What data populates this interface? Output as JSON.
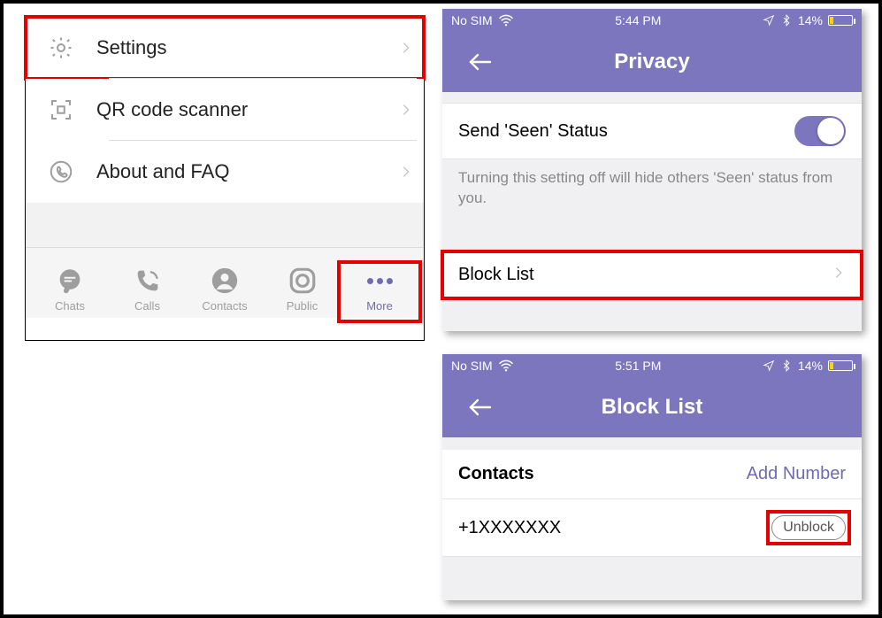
{
  "left": {
    "rows": {
      "settings": "Settings",
      "qr": "QR code scanner",
      "about": "About and FAQ"
    },
    "tabs": {
      "chats": "Chats",
      "calls": "Calls",
      "contacts": "Contacts",
      "public": "Public",
      "more": "More"
    }
  },
  "privacy": {
    "status": {
      "carrier": "No SIM",
      "time": "5:44 PM",
      "battery": "14%"
    },
    "title": "Privacy",
    "seen_label": "Send 'Seen' Status",
    "seen_desc": "Turning this setting off will hide others 'Seen' status from you.",
    "blocklist_label": "Block List"
  },
  "blocklist": {
    "status": {
      "carrier": "No SIM",
      "time": "5:51 PM",
      "battery": "14%"
    },
    "title": "Block List",
    "section": "Contacts",
    "add_label": "Add Number",
    "entries": [
      {
        "number": "+1XXXXXXX",
        "action": "Unblock"
      }
    ]
  }
}
